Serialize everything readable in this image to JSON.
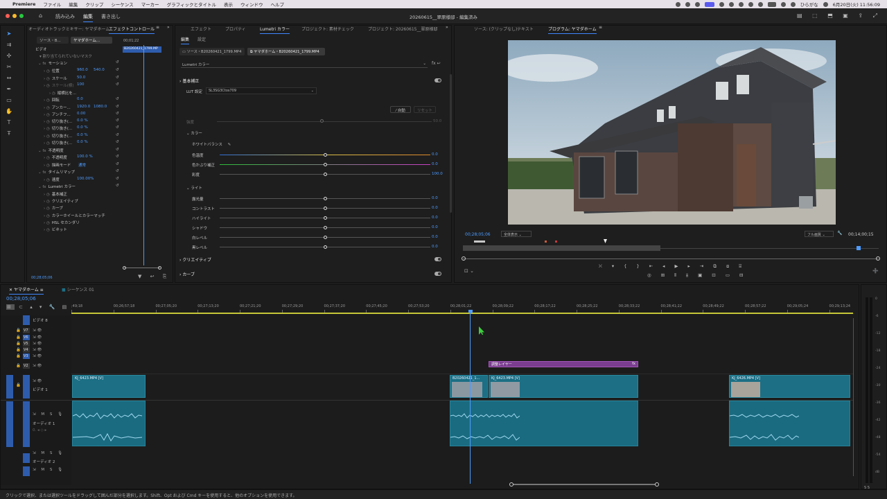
{
  "menubar": {
    "app": "Premiere",
    "items": [
      "ファイル",
      "編集",
      "クリップ",
      "シーケンス",
      "マーカー",
      "グラフィックとタイトル",
      "表示",
      "ウィンドウ",
      "ヘルプ"
    ],
    "ime": "ひらがな",
    "clock": "6月20日(火) 11:56:09"
  },
  "titlebar": {
    "workspaces": [
      "読み込み",
      "編集",
      "書き出し"
    ],
    "active_workspace": "編集",
    "project_title": "20260615__翠原様邸 - 編集済み"
  },
  "effect_controls": {
    "tabs": [
      "オーディオトラックミキサー: ヤマダホーム",
      "エフェクトコントロール"
    ],
    "source_tab": "ソース・B...",
    "seq_tab": "ヤマダホーム...",
    "mini_timecode": "00;01;22",
    "mini_clip": "B20260421_1799.MP",
    "section_video": "ビデオ",
    "mask_note": "割り当てられていないマスク",
    "props": [
      {
        "name": "モーション",
        "indent": 1
      },
      {
        "name": "位置",
        "value": "960.0",
        "value2": "540.0",
        "indent": 2
      },
      {
        "name": "スケール",
        "value": "50.0",
        "indent": 2
      },
      {
        "name": "スケール(横)",
        "value": "100",
        "indent": 2,
        "dim": true
      },
      {
        "name": "縦横比を...",
        "indent": 3
      },
      {
        "name": "回転",
        "value": "0.0",
        "indent": 2
      },
      {
        "name": "アンカー...",
        "value": "1920.0",
        "value2": "1080.0",
        "indent": 2
      },
      {
        "name": "アンチフ...",
        "value": "0.00",
        "indent": 2
      },
      {
        "name": "切り抜き(...",
        "value": "0.0 %",
        "indent": 2
      },
      {
        "name": "切り抜き(...",
        "value": "0.0 %",
        "indent": 2
      },
      {
        "name": "切り抜き(...",
        "value": "0.0 %",
        "indent": 2
      },
      {
        "name": "切り抜き(...",
        "value": "0.0 %",
        "indent": 2
      },
      {
        "name": "不透明度",
        "indent": 1
      },
      {
        "name": "不透明度",
        "value": "100.0 %",
        "indent": 2
      },
      {
        "name": "描画モード",
        "value": "通常",
        "indent": 2
      },
      {
        "name": "タイムリマップ",
        "indent": 1
      },
      {
        "name": "速度",
        "value": "100.00%",
        "indent": 2
      },
      {
        "name": "Lumetri カラー",
        "indent": 1
      },
      {
        "name": "基本補正",
        "indent": 2
      },
      {
        "name": "クリエイティブ",
        "indent": 2
      },
      {
        "name": "カーブ",
        "indent": 2
      },
      {
        "name": "カラーホイールとカラーマッチ",
        "indent": 2
      },
      {
        "name": "HSL セカンダリ",
        "indent": 2
      },
      {
        "name": "ビネット",
        "indent": 2
      }
    ],
    "bottom_timecode": "00;28;05;06"
  },
  "lumetri": {
    "tabs": [
      "エフェクト",
      "プロパティ",
      "Lumetri カラー",
      "プロジェクト: 素材チェック",
      "プロジェクト: 20260615__翠原様邸"
    ],
    "active_tab": "Lumetri カラー",
    "subtabs": [
      "編集",
      "設定"
    ],
    "source_clip": "ソース・B20260421_1799.MP4",
    "seq_clip": "ヤマダホーム・B20260421_1799.MP4",
    "effect_select": "Lumetri カラー",
    "section_basic": "基本補正",
    "lut_label": "LUT 設定",
    "lut_value": "SL3SG3Ctos709",
    "auto_btn": "自動",
    "reset_btn": "リセット",
    "intensity_label": "強度",
    "intensity_value": "50.0",
    "color_section": "カラー",
    "wb_label": "ホワイトバランス",
    "color_sliders": [
      {
        "label": "色温度",
        "value": "0.0",
        "pos": 0.5,
        "kind": "temp"
      },
      {
        "label": "色かぶり補正",
        "value": "0.0",
        "pos": 0.5,
        "kind": "tint"
      },
      {
        "label": "彩度",
        "value": "100.0",
        "pos": 0.5,
        "kind": "plain"
      }
    ],
    "light_section": "ライト",
    "light_sliders": [
      {
        "label": "露光量",
        "value": "0.0",
        "pos": 0.5
      },
      {
        "label": "コントラスト",
        "value": "0.0",
        "pos": 0.5
      },
      {
        "label": "ハイライト",
        "value": "0.0",
        "pos": 0.5
      },
      {
        "label": "シャドウ",
        "value": "0.0",
        "pos": 0.5
      },
      {
        "label": "白レベル",
        "value": "0.0",
        "pos": 0.5
      },
      {
        "label": "黒レベル",
        "value": "0.0",
        "pos": 0.5
      }
    ],
    "creative": "クリエイティブ",
    "curves": "カーブ"
  },
  "program": {
    "tabs": [
      "ソース: (クリップなし)",
      "テキスト",
      "プログラム: ヤマダホーム"
    ],
    "active_tab": "プログラム: ヤマダホーム",
    "timecode": "00;28;05;06",
    "fit": "全体表示",
    "quality": "フル画質",
    "duration": "00;14;00;15"
  },
  "timeline": {
    "tabs": [
      "ヤマダホーム",
      "シーケンス 01"
    ],
    "timecode": "00;28;05;06",
    "ruler": [
      ";49;18",
      "00;26;57;18",
      "00;27;05;20",
      "00;27;13;20",
      "00;27;21;20",
      "00;27;29;20",
      "00;27;37;20",
      "00;27;45;20",
      "00;27;53;20",
      "00;28;01;22",
      "00;28;09;22",
      "00;28;17;22",
      "00;28;25;22",
      "00;28;33;22",
      "00;28;41;22",
      "00;28;49;22",
      "00;28;57;22",
      "00;29;05;24",
      "00;29;13;24"
    ],
    "tracks_video": [
      "ビデオ 8",
      "V7",
      "V6",
      "V5",
      "V4",
      "V3",
      "V2",
      "V1"
    ],
    "v1_name": "ビデオ 1",
    "a1_name": "オーディオ 1",
    "a2_name": "オーディオ 2",
    "adj_layer": "調整レイヤー",
    "clips": [
      {
        "label": "KJ_6423.MP4 [V]"
      },
      {
        "label": "B20260421_1..."
      },
      {
        "label": "KJ_6423.MP4 [V]"
      },
      {
        "label": "KJ_6426.MP4 [V]"
      }
    ],
    "meter_ticks": [
      "0",
      "-6",
      "-12",
      "-18",
      "-24",
      "-30",
      "-36",
      "-42",
      "-48",
      "-54",
      "dB"
    ]
  },
  "status": "クリックで選択、または選択ツールをドラッグして囲んだ部分を選択します。Shift、Opt および Cmd キーを使用すると、他のオプションを使用できます。"
}
